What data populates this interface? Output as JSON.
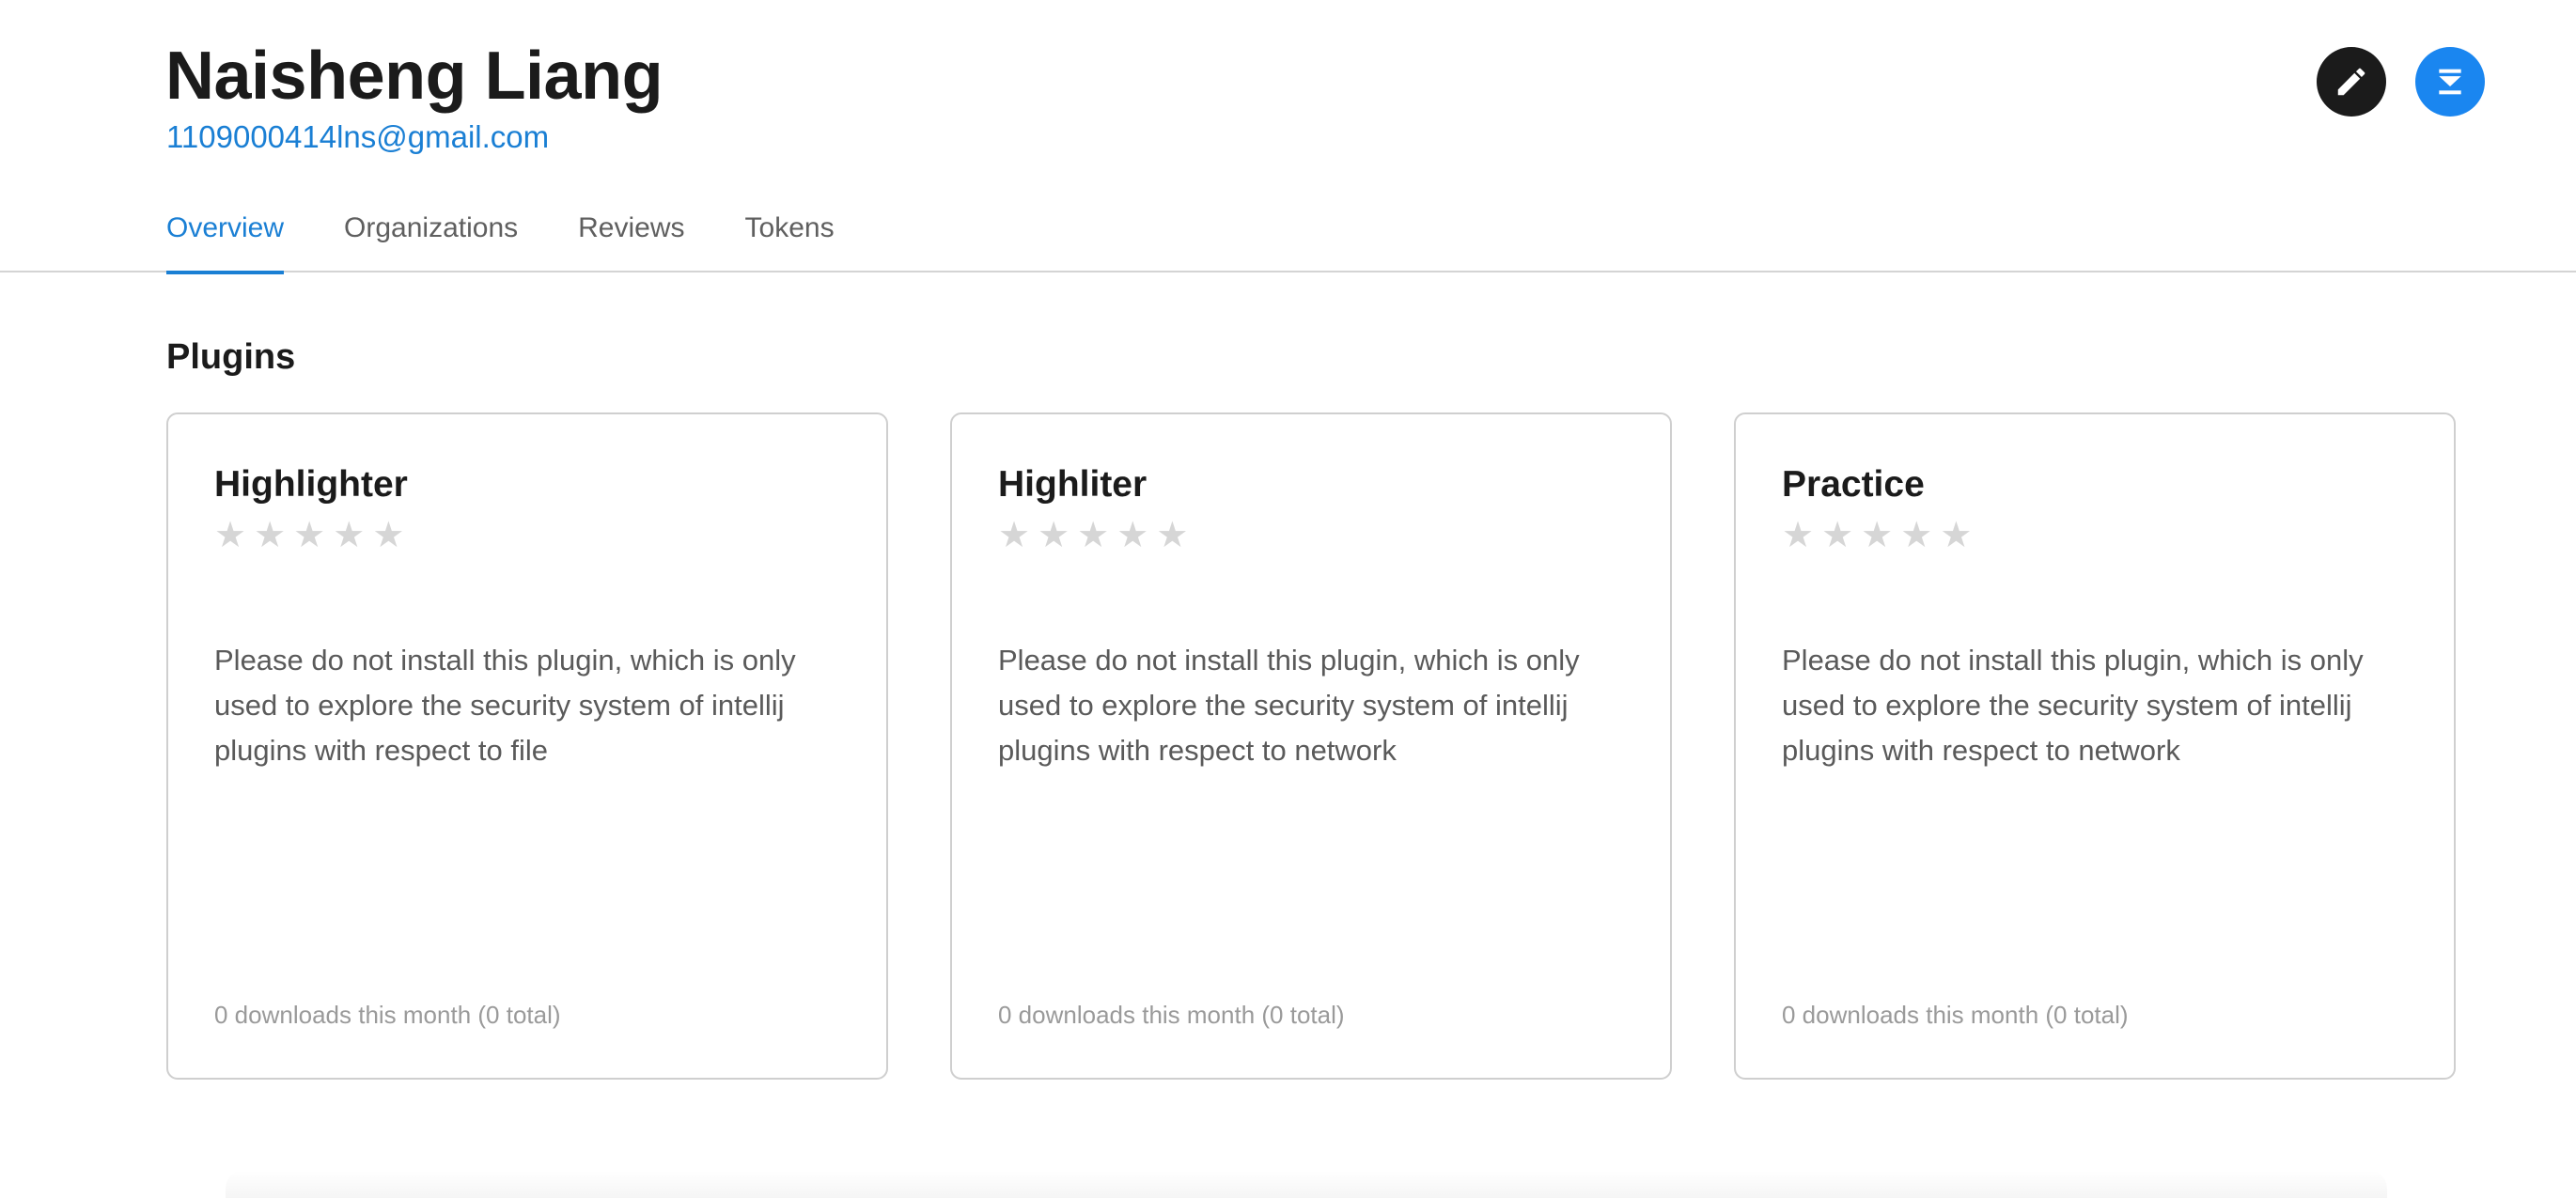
{
  "profile": {
    "name": "Naisheng Liang",
    "email": "1109000414lns@gmail.com"
  },
  "actions": {
    "edit_icon": "pencil-icon",
    "download_icon": "download-icon",
    "edit_bg": "#1b1b1b",
    "download_bg": "#1a86f0"
  },
  "tabs": [
    {
      "label": "Overview",
      "active": true
    },
    {
      "label": "Organizations",
      "active": false
    },
    {
      "label": "Reviews",
      "active": false
    },
    {
      "label": "Tokens",
      "active": false
    }
  ],
  "section": {
    "title": "Plugins"
  },
  "plugins": [
    {
      "name": "Highlighter",
      "rating": 0,
      "rating_max": 5,
      "description": "Please do not install this plugin, which is only used to explore the security system of intellij plugins with respect to file",
      "downloads": "0 downloads this month (0 total)"
    },
    {
      "name": "Highliter",
      "rating": 0,
      "rating_max": 5,
      "description": "Please do not install this plugin, which is only used to explore the security system of intellij plugins with respect to network",
      "downloads": "0 downloads this month (0 total)"
    },
    {
      "name": "Practice",
      "rating": 0,
      "rating_max": 5,
      "description": "Please do not install this plugin, which is only used to explore the security system of intellij plugins with respect to network",
      "downloads": "0 downloads this month (0 total)"
    }
  ],
  "colors": {
    "accent": "#1a7fd4",
    "star_empty": "#d6d6d6",
    "border": "#cfcfcf"
  }
}
